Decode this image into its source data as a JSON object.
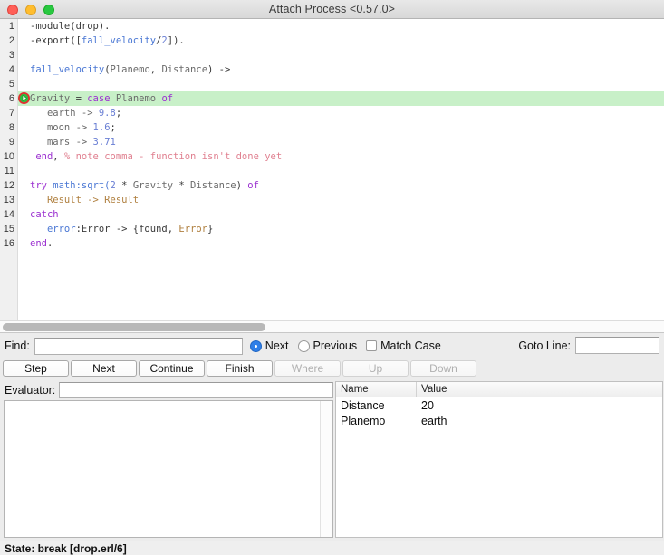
{
  "window": {
    "title": "Attach Process <0.57.0>",
    "traffic_lights": [
      "close-button",
      "minimize-button",
      "zoom-button"
    ]
  },
  "editor": {
    "current_line": 6,
    "highlight_color": "#c8f0c8",
    "breakpoint_marker_icon": "current-line-arrow-icon",
    "lines": [
      {
        "n": "1",
        "tokens": [
          {
            "t": "-module(drop).",
            "c": "plain"
          }
        ]
      },
      {
        "n": "2",
        "tokens": [
          {
            "t": "-export([",
            "c": "plain"
          },
          {
            "t": "fall_velocity",
            "c": "fn"
          },
          {
            "t": "/",
            "c": "plain"
          },
          {
            "t": "2",
            "c": "num"
          },
          {
            "t": "]).",
            "c": "plain"
          }
        ]
      },
      {
        "n": "3",
        "tokens": [
          {
            "t": "",
            "c": "plain"
          }
        ]
      },
      {
        "n": "4",
        "tokens": [
          {
            "t": "fall_velocity",
            "c": "fn"
          },
          {
            "t": "(",
            "c": "plain"
          },
          {
            "t": "Planemo",
            "c": "atom"
          },
          {
            "t": ", ",
            "c": "plain"
          },
          {
            "t": "Distance",
            "c": "atom"
          },
          {
            "t": ") ->",
            "c": "plain"
          }
        ]
      },
      {
        "n": "5",
        "tokens": [
          {
            "t": "",
            "c": "plain"
          }
        ]
      },
      {
        "n": "6",
        "tokens": [
          {
            "t": "Gravity",
            "c": "atom"
          },
          {
            "t": " = ",
            "c": "plain"
          },
          {
            "t": "case",
            "c": "kw"
          },
          {
            "t": " ",
            "c": "plain"
          },
          {
            "t": "Planemo",
            "c": "atom"
          },
          {
            "t": " ",
            "c": "plain"
          },
          {
            "t": "of",
            "c": "kw"
          }
        ]
      },
      {
        "n": "7",
        "tokens": [
          {
            "t": "   earth -> ",
            "c": "atom"
          },
          {
            "t": "9.8",
            "c": "num"
          },
          {
            "t": ";",
            "c": "plain"
          }
        ]
      },
      {
        "n": "8",
        "tokens": [
          {
            "t": "   moon -> ",
            "c": "atom"
          },
          {
            "t": "1.6",
            "c": "num"
          },
          {
            "t": ";",
            "c": "plain"
          }
        ]
      },
      {
        "n": "9",
        "tokens": [
          {
            "t": "   mars -> ",
            "c": "atom"
          },
          {
            "t": "3.71",
            "c": "num"
          }
        ]
      },
      {
        "n": "10",
        "tokens": [
          {
            "t": " ",
            "c": "plain"
          },
          {
            "t": "end",
            "c": "kw"
          },
          {
            "t": ", ",
            "c": "plain"
          },
          {
            "t": "% note comma - function isn't done yet",
            "c": "cmt"
          }
        ]
      },
      {
        "n": "11",
        "tokens": [
          {
            "t": "",
            "c": "plain"
          }
        ]
      },
      {
        "n": "12",
        "tokens": [
          {
            "t": "try",
            "c": "kw"
          },
          {
            "t": " math:sqrt(",
            "c": "fn"
          },
          {
            "t": "2",
            "c": "num"
          },
          {
            "t": " * ",
            "c": "plain"
          },
          {
            "t": "Gravity",
            "c": "atom"
          },
          {
            "t": " * ",
            "c": "plain"
          },
          {
            "t": "Distance",
            "c": "atom"
          },
          {
            "t": ") ",
            "c": "plain"
          },
          {
            "t": "of",
            "c": "kw"
          }
        ]
      },
      {
        "n": "13",
        "tokens": [
          {
            "t": "   Result -> Result",
            "c": "var"
          }
        ]
      },
      {
        "n": "14",
        "tokens": [
          {
            "t": "catch",
            "c": "kw"
          }
        ]
      },
      {
        "n": "15",
        "tokens": [
          {
            "t": "   ",
            "c": "plain"
          },
          {
            "t": "error",
            "c": "fn"
          },
          {
            "t": ":Error -> {found, ",
            "c": "plain"
          },
          {
            "t": "Error",
            "c": "var"
          },
          {
            "t": "}",
            "c": "plain"
          }
        ]
      },
      {
        "n": "16",
        "tokens": [
          {
            "t": "end",
            "c": "kw"
          },
          {
            "t": ".",
            "c": "plain"
          }
        ]
      }
    ]
  },
  "scrollbar": {
    "horizontal_thumb_width_px": "290"
  },
  "find": {
    "label": "Find:",
    "value": "",
    "placeholder": "",
    "next_label": "Next",
    "previous_label": "Previous",
    "match_case_label": "Match Case",
    "direction_selected": "Next",
    "match_case_checked": false,
    "goto_line_label": "Goto Line:",
    "goto_line_value": "",
    "goto_line_placeholder": ""
  },
  "buttons": [
    {
      "label": "Step",
      "enabled": true
    },
    {
      "label": "Next",
      "enabled": true
    },
    {
      "label": "Continue",
      "enabled": true
    },
    {
      "label": "Finish",
      "enabled": true
    },
    {
      "label": "Where",
      "enabled": false
    },
    {
      "label": "Up",
      "enabled": false
    },
    {
      "label": "Down",
      "enabled": false
    }
  ],
  "evaluator": {
    "label": "Evaluator:",
    "value": "",
    "placeholder": "",
    "output": ""
  },
  "variables": {
    "columns": [
      "Name",
      "Value"
    ],
    "rows": [
      {
        "name": "Distance",
        "value": "20"
      },
      {
        "name": "Planemo",
        "value": "earth"
      }
    ]
  },
  "status": {
    "text": "State: break [drop.erl/6]"
  },
  "colors": {
    "accent": "#2f7fe8",
    "highlight": "#c8f0c8",
    "keyword": "#9b30d0",
    "function": "#4a77d4",
    "number": "#6a7fd4",
    "comment": "#e08090",
    "variable": "#b08040"
  }
}
